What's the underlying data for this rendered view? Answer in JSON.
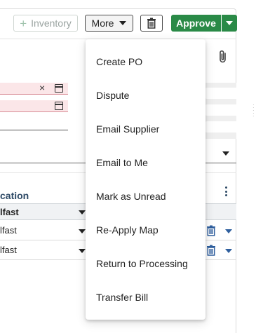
{
  "toolbar": {
    "inventory_label": "Inventory",
    "more_label": "More",
    "approve_label": "Approve"
  },
  "form": {
    "clear_symbol": "×"
  },
  "table": {
    "column_title": "cation",
    "header_value": "lfast",
    "rows": [
      {
        "value": "lfast"
      },
      {
        "value": "lfast"
      }
    ]
  },
  "more_menu": {
    "items": [
      {
        "label": "Create PO"
      },
      {
        "label": "Dispute"
      },
      {
        "label": "Email Supplier"
      },
      {
        "label": "Email to Me"
      },
      {
        "label": "Mark as Unread"
      },
      {
        "label": "Re-Apply Map"
      },
      {
        "label": "Return to Processing"
      },
      {
        "label": "Transfer Bill"
      }
    ]
  },
  "colors": {
    "approve": "#2a8a47",
    "error_field": "#fbe6e8",
    "link_blue": "#2f5f9e"
  },
  "icons": [
    "plus-icon",
    "chevron-down-icon",
    "trash-icon",
    "paperclip-icon",
    "calendar-icon",
    "close-icon",
    "kebab-menu-icon"
  ]
}
